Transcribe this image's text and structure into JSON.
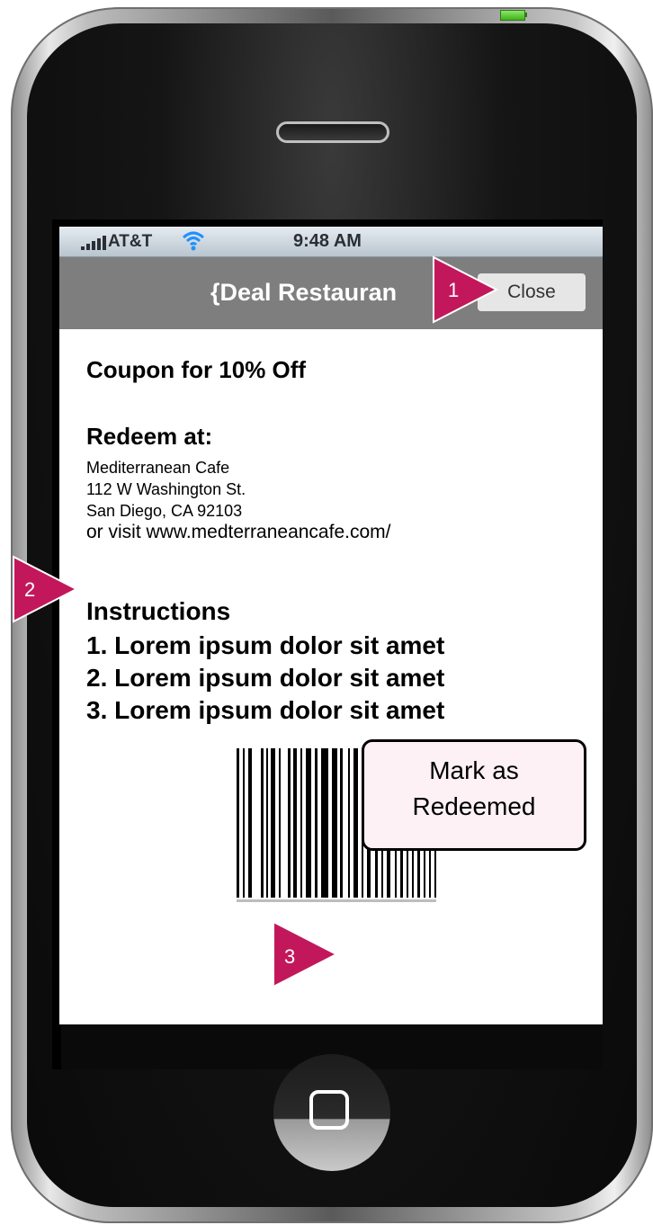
{
  "status_bar": {
    "carrier": "AT&T",
    "time": "9:48 AM"
  },
  "nav": {
    "title": "{Deal Restauran",
    "close_label": "Close"
  },
  "coupon": {
    "title": "Coupon for 10% Off",
    "redeem_heading": "Redeem at:",
    "address_lines": [
      "Mediterranean Cafe",
      "112 W Washington St.",
      "San Diego, CA 92103",
      "or visit www.medterraneancafe.com/"
    ]
  },
  "instructions": {
    "heading": "Instructions",
    "items": [
      "1. Lorem ipsum dolor sit amet",
      "2. Lorem ipsum dolor sit amet",
      "3. Lorem ipsum dolor sit amet"
    ]
  },
  "redeem_button": {
    "line1": "Mark as",
    "line2": "Redeemed"
  },
  "annotations": {
    "marker1": "1",
    "marker2": "2",
    "marker3": "3",
    "color": "#c2185b"
  },
  "colors": {
    "navbar": "#7e7e7e",
    "redeem_button_bg": "#fdf1f6"
  }
}
